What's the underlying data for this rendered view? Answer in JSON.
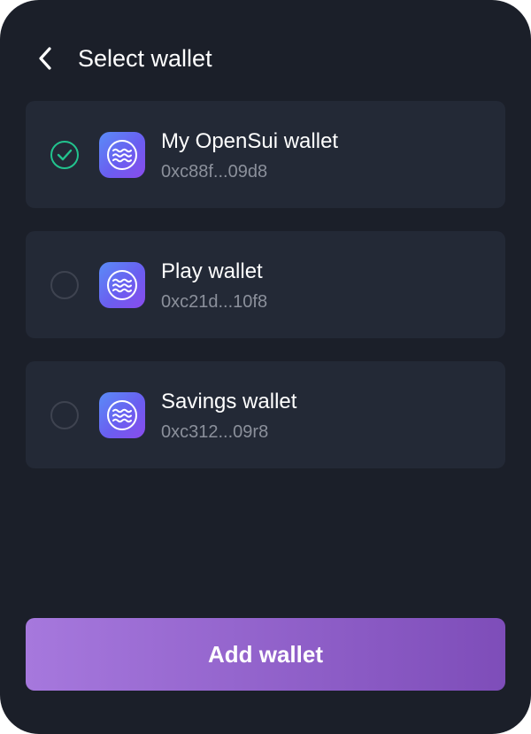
{
  "header": {
    "back_icon": "chevron-left-icon",
    "title": "Select wallet"
  },
  "wallets": [
    {
      "name": "My OpenSui wallet",
      "address": "0xc88f...09d8",
      "selected": true,
      "icon": "waves-icon"
    },
    {
      "name": "Play wallet",
      "address": "0xc21d...10f8",
      "selected": false,
      "icon": "waves-icon"
    },
    {
      "name": "Savings wallet",
      "address": "0xc312...09r8",
      "selected": false,
      "icon": "waves-icon"
    }
  ],
  "footer": {
    "add_label": "Add wallet"
  },
  "colors": {
    "background": "#1b1f29",
    "card": "#232936",
    "check_accent": "#22c38e",
    "button_gradient_start": "#a678dd",
    "button_gradient_end": "#7e4db9",
    "secondary_text": "#8b909b"
  }
}
